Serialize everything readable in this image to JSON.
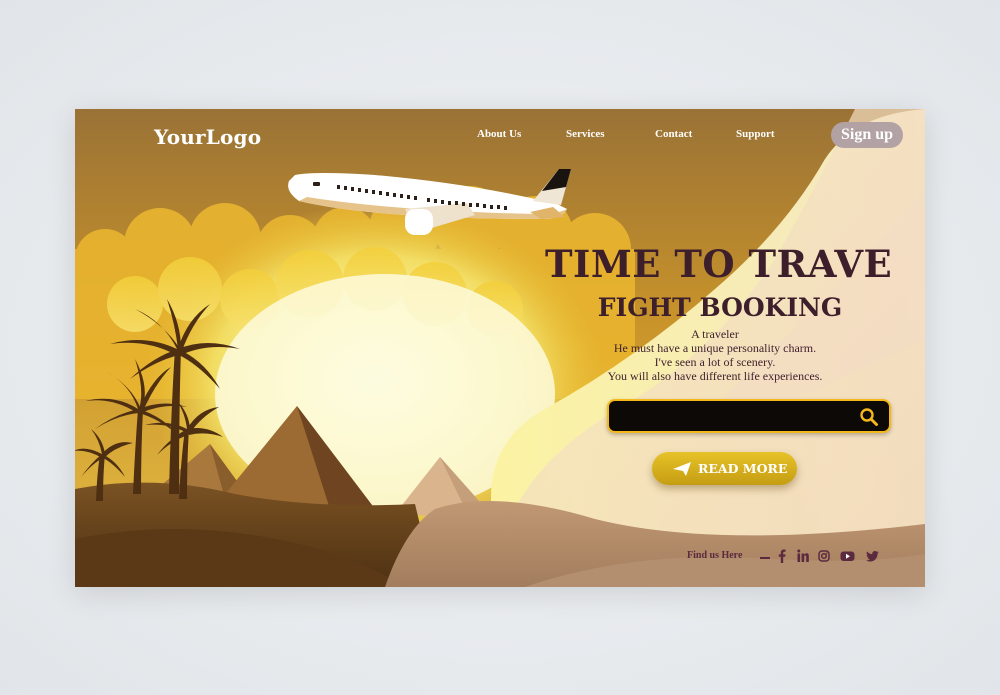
{
  "header": {
    "logo": "YourLogo",
    "nav": [
      {
        "label": "About Us"
      },
      {
        "label": "Services"
      },
      {
        "label": "Contact"
      },
      {
        "label": "Support"
      }
    ],
    "signup_label": "Sign up"
  },
  "hero": {
    "title": "TIME TO TRAVE",
    "subtitle": "FIGHT BOOKING",
    "description": [
      "A traveler",
      "He must have a unique personality charm.",
      "I've seen a lot of scenery.",
      "You will also have different life experiences."
    ],
    "search": {
      "value": "",
      "placeholder": "",
      "icon": "search-icon"
    },
    "read_more_label": "READ MORE",
    "read_more_icon": "send-arrow-icon"
  },
  "footer": {
    "find_us": "Find us Here",
    "social_icons": [
      "facebook-icon",
      "linkedin-icon",
      "instagram-icon",
      "youtube-icon",
      "twitter-icon"
    ]
  },
  "colors": {
    "sky_top": "#a47a36",
    "sun_glow": "#f8ef75",
    "title_color": "#3d1f2c",
    "signup_bg": "#b3a2a3",
    "search_bg": "#0d0906",
    "search_border": "#f4b81b",
    "button_gold": "#d7ad1d",
    "social_color": "#5b2a3f"
  }
}
